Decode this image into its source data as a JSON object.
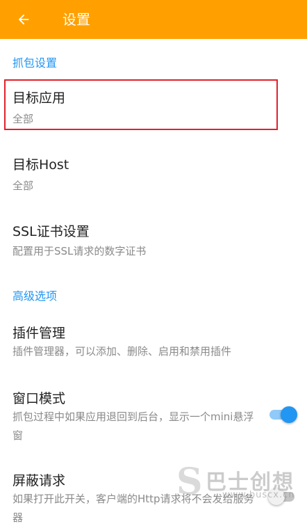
{
  "appbar": {
    "title": "设置",
    "back_icon": "arrow-back-icon",
    "color": "#FFA000"
  },
  "sections": {
    "capture": {
      "header": "抓包设置",
      "target_app": {
        "title": "目标应用",
        "summary": "全部"
      },
      "target_host": {
        "title": "目标Host",
        "summary": "全部"
      },
      "ssl": {
        "title": "SSL证书设置",
        "summary": "配置用于SSL请求的数字证书"
      }
    },
    "advanced": {
      "header": "高级选项",
      "plugins": {
        "title": "插件管理",
        "summary": "插件管理器，可以添加、删除、启用和禁用插件"
      },
      "window_mode": {
        "title": "窗口模式",
        "summary": "抓包过程中如果应用退回到后台，显示一个mini悬浮窗",
        "enabled": true
      },
      "block_requests": {
        "title": "屏蔽请求",
        "summary": "如果打开此开关，客户端的Http请求将不会发给服务器",
        "enabled": false
      }
    }
  },
  "accent_color": "#2196F3",
  "highlight_color": "#e0202a",
  "watermark": {
    "logo": "S",
    "text": "巴士创想",
    "url": "www.buscx.cn"
  }
}
